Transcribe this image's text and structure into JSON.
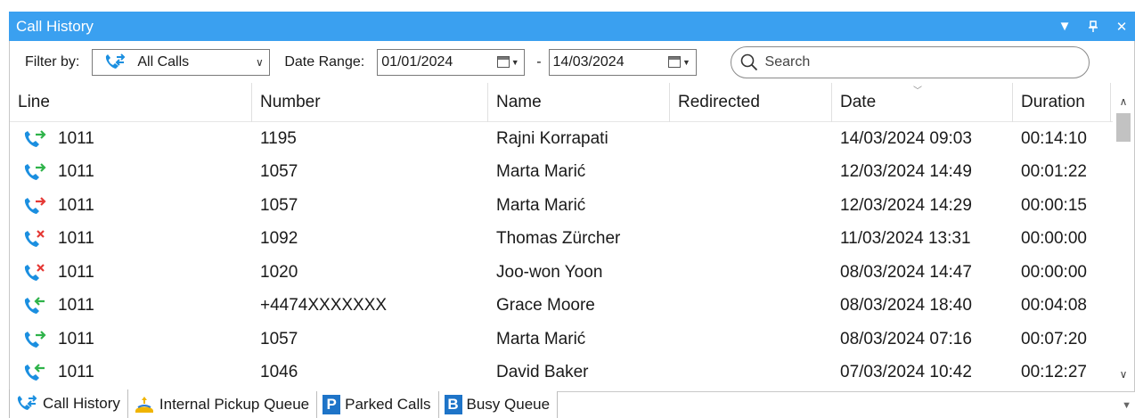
{
  "window": {
    "title": "Call History",
    "controls": [
      "dropdown",
      "pin",
      "close"
    ]
  },
  "filter": {
    "filter_by_label": "Filter by:",
    "call_type": "All Calls",
    "date_range_label": "Date Range:",
    "date_from": "01/01/2024",
    "date_separator": "-",
    "date_to": "14/03/2024",
    "search_placeholder": "Search"
  },
  "table": {
    "columns": [
      "Line",
      "Number",
      "Name",
      "Redirected",
      "Date",
      "Duration"
    ],
    "sorted_column": "Date",
    "rows": [
      {
        "icon": "outgoing-call-icon",
        "line": "1011",
        "number": "1195",
        "name": "Rajni Korrapati",
        "redirected": "",
        "date": "14/03/2024 09:03",
        "duration": "00:14:10"
      },
      {
        "icon": "outgoing-call-icon",
        "line": "1011",
        "number": "1057",
        "name": "Marta Marić",
        "redirected": "",
        "date": "12/03/2024 14:49",
        "duration": "00:01:22"
      },
      {
        "icon": "outgoing-unanswered-call-icon",
        "line": "1011",
        "number": "1057",
        "name": "Marta Marić",
        "redirected": "",
        "date": "12/03/2024 14:29",
        "duration": "00:00:15"
      },
      {
        "icon": "missed-call-icon",
        "line": "1011",
        "number": "1092",
        "name": "Thomas Zürcher",
        "redirected": "",
        "date": "11/03/2024 13:31",
        "duration": "00:00:00"
      },
      {
        "icon": "missed-call-icon",
        "line": "1011",
        "number": "1020",
        "name": "Joo-won Yoon",
        "redirected": "",
        "date": "08/03/2024 14:47",
        "duration": "00:00:00"
      },
      {
        "icon": "incoming-call-icon",
        "line": "1011",
        "number": "+4474XXXXXXX",
        "name": "Grace Moore",
        "redirected": "",
        "date": "08/03/2024 18:40",
        "duration": "00:04:08"
      },
      {
        "icon": "outgoing-call-icon",
        "line": "1011",
        "number": "1057",
        "name": "Marta Marić",
        "redirected": "",
        "date": "08/03/2024 07:16",
        "duration": "00:07:20"
      },
      {
        "icon": "incoming-call-icon",
        "line": "1011",
        "number": "1046",
        "name": "David Baker",
        "redirected": "",
        "date": "07/03/2024 10:42",
        "duration": "00:12:27"
      }
    ]
  },
  "tabs": [
    {
      "label": "Call History",
      "icon": "call-history-icon",
      "active": true
    },
    {
      "label": "Internal Pickup Queue",
      "icon": "pickup-queue-icon",
      "active": false
    },
    {
      "label": "Parked Calls",
      "icon": "parked-calls-icon",
      "badge": "P",
      "active": false
    },
    {
      "label": "Busy Queue",
      "icon": "busy-queue-icon",
      "badge": "B",
      "active": false
    }
  ],
  "colors": {
    "titlebar": "#3aa0f0",
    "phone": "#1b8fe0",
    "outgoing_arrow": "#2fb34a",
    "incoming_arrow": "#2fb34a",
    "missed_x": "#e53935",
    "badge": "#1e74c8"
  }
}
